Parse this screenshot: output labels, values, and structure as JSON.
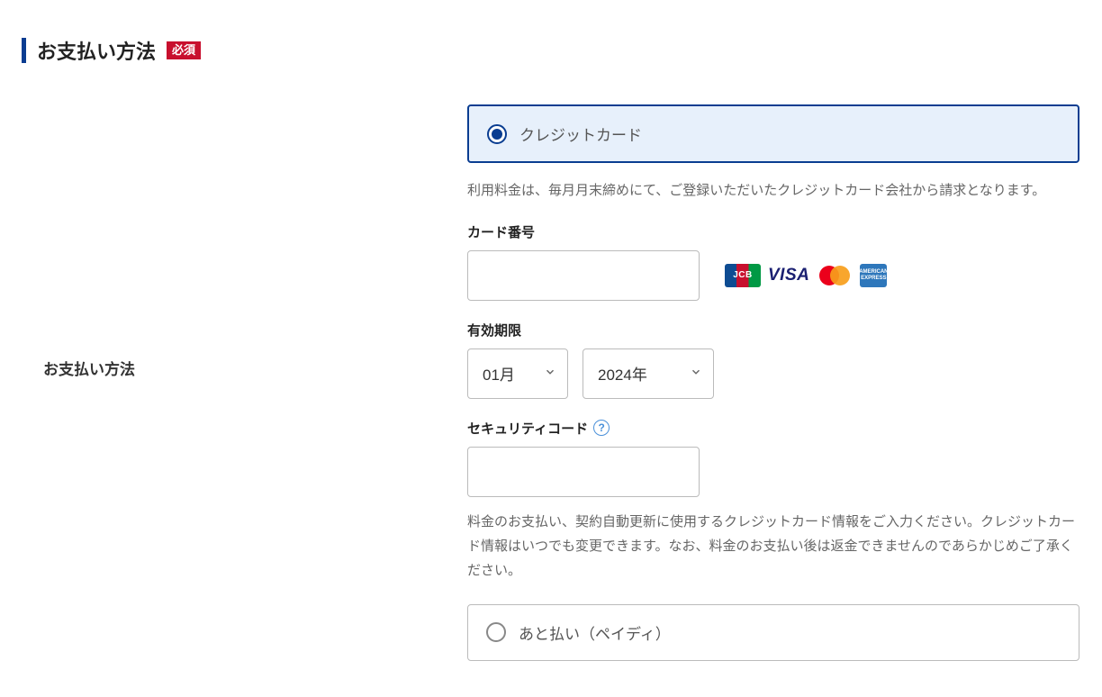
{
  "section": {
    "title": "お支払い方法",
    "required_label": "必須"
  },
  "row_label": "お支払い方法",
  "credit_card": {
    "radio_label": "クレジットカード",
    "description": "利用料金は、毎月月末締めにて、ご登録いただいたクレジットカード会社から請求となります。",
    "card_number_label": "カード番号",
    "brands": {
      "jcb": "JCB",
      "visa": "VISA",
      "amex": "AMERICAN EXPRESS"
    },
    "expiry_label": "有効期限",
    "expiry_month": "01月",
    "expiry_year": "2024年",
    "security_label": "セキュリティコード",
    "note": "料金のお支払い、契約自動更新に使用するクレジットカード情報をご入力ください。クレジットカード情報はいつでも変更できます。なお、料金のお支払い後は返金できませんのであらかじめご了承ください。"
  },
  "paidy": {
    "radio_label": "あと払い（ペイディ）"
  }
}
